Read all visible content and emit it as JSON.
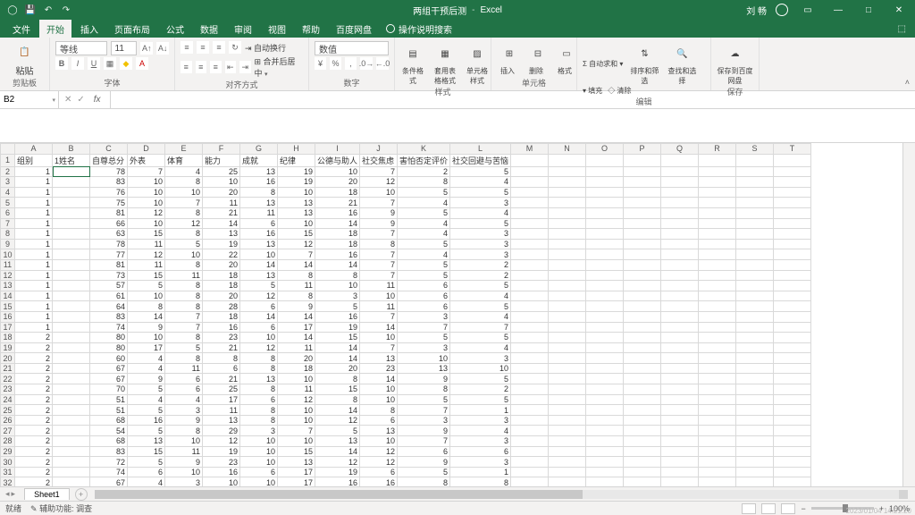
{
  "titlebar": {
    "doc_title": "两组干预后测",
    "app_name": "Excel",
    "user_name": "刘 畅"
  },
  "tabs": {
    "file": "文件",
    "home": "开始",
    "insert": "插入",
    "layout": "页面布局",
    "formulas": "公式",
    "data": "数据",
    "review": "审阅",
    "view": "视图",
    "help": "帮助",
    "baidu": "百度网盘",
    "tell": "操作说明搜索"
  },
  "ribbon": {
    "paste": "粘贴",
    "clipboard": "剪贴板",
    "font_name": "等线",
    "font_size": "11",
    "font_group": "字体",
    "wrap": "自动换行",
    "merge": "合并后居中",
    "align_group": "对齐方式",
    "number_fmt": "数值",
    "number_group": "数字",
    "cond_fmt": "条件格式",
    "tbl_fmt": "套用表格格式",
    "cell_style": "单元格样式",
    "styles_group": "样式",
    "insert_c": "插入",
    "delete_c": "删除",
    "format_c": "格式",
    "cells_group": "单元格",
    "autosum": "自动求和",
    "fill": "填充",
    "clear": "清除",
    "sort": "排序和筛选",
    "find": "查找和选择",
    "editing_group": "编辑",
    "save_cloud": "保存到百度网盘",
    "save_group": "保存"
  },
  "formula": {
    "cell_ref": "B2",
    "fx": "fx"
  },
  "columns": [
    "A",
    "B",
    "C",
    "D",
    "E",
    "F",
    "G",
    "H",
    "I",
    "J",
    "K",
    "L",
    "M",
    "N",
    "O",
    "P",
    "Q",
    "R",
    "S",
    "T"
  ],
  "headers": [
    "组别",
    "1姓名",
    "自尊总分",
    "外表",
    "体育",
    "能力",
    "成就",
    "纪律",
    "公德与助人",
    "社交焦虑",
    "害怕否定评价",
    "社交回避与苦恼"
  ],
  "rows": [
    [
      1,
      "",
      78,
      7,
      4,
      25,
      13,
      19,
      10,
      7,
      2,
      5
    ],
    [
      1,
      "",
      83,
      10,
      8,
      10,
      16,
      19,
      20,
      12,
      8,
      4
    ],
    [
      1,
      "",
      76,
      10,
      10,
      20,
      8,
      10,
      18,
      10,
      5,
      5
    ],
    [
      1,
      "",
      75,
      10,
      7,
      11,
      13,
      13,
      21,
      7,
      4,
      3
    ],
    [
      1,
      "",
      81,
      12,
      8,
      21,
      11,
      13,
      16,
      9,
      5,
      4
    ],
    [
      1,
      "",
      66,
      10,
      12,
      14,
      6,
      10,
      14,
      9,
      4,
      5
    ],
    [
      1,
      "",
      63,
      15,
      8,
      13,
      16,
      15,
      18,
      7,
      4,
      3
    ],
    [
      1,
      "",
      78,
      11,
      5,
      19,
      13,
      12,
      18,
      8,
      5,
      3
    ],
    [
      1,
      "",
      77,
      12,
      10,
      22,
      10,
      7,
      16,
      7,
      4,
      3
    ],
    [
      1,
      "",
      81,
      11,
      8,
      20,
      14,
      14,
      14,
      7,
      5,
      2
    ],
    [
      1,
      "",
      73,
      15,
      11,
      18,
      13,
      8,
      8,
      7,
      5,
      2
    ],
    [
      1,
      "",
      57,
      5,
      8,
      18,
      5,
      11,
      10,
      11,
      6,
      5
    ],
    [
      1,
      "",
      61,
      10,
      8,
      20,
      12,
      8,
      3,
      10,
      6,
      4
    ],
    [
      1,
      "",
      64,
      8,
      8,
      28,
      6,
      9,
      5,
      11,
      6,
      5
    ],
    [
      1,
      "",
      83,
      14,
      7,
      18,
      14,
      14,
      16,
      7,
      3,
      4
    ],
    [
      1,
      "",
      74,
      9,
      7,
      16,
      6,
      17,
      19,
      14,
      7,
      7
    ],
    [
      2,
      "",
      80,
      10,
      8,
      23,
      10,
      14,
      15,
      10,
      5,
      5
    ],
    [
      2,
      "",
      80,
      17,
      5,
      21,
      12,
      11,
      14,
      7,
      3,
      4
    ],
    [
      2,
      "",
      60,
      4,
      8,
      8,
      8,
      20,
      14,
      13,
      10,
      3
    ],
    [
      2,
      "",
      67,
      4,
      11,
      6,
      8,
      18,
      20,
      23,
      13,
      10
    ],
    [
      2,
      "",
      67,
      9,
      6,
      21,
      13,
      10,
      8,
      14,
      9,
      5
    ],
    [
      2,
      "",
      70,
      5,
      6,
      25,
      8,
      11,
      15,
      10,
      8,
      2
    ],
    [
      2,
      "",
      51,
      4,
      4,
      17,
      6,
      12,
      8,
      10,
      5,
      5
    ],
    [
      2,
      "",
      51,
      5,
      3,
      11,
      8,
      10,
      14,
      8,
      7,
      1
    ],
    [
      2,
      "",
      68,
      16,
      9,
      13,
      8,
      10,
      12,
      6,
      3,
      3
    ],
    [
      2,
      "",
      54,
      5,
      8,
      29,
      3,
      7,
      5,
      13,
      9,
      4
    ],
    [
      2,
      "",
      68,
      13,
      10,
      12,
      10,
      10,
      13,
      10,
      7,
      3
    ],
    [
      2,
      "",
      83,
      15,
      11,
      19,
      10,
      15,
      14,
      12,
      6,
      6
    ],
    [
      2,
      "",
      72,
      5,
      9,
      23,
      10,
      13,
      12,
      12,
      9,
      3
    ],
    [
      2,
      "",
      74,
      6,
      10,
      16,
      6,
      17,
      19,
      6,
      5,
      1
    ],
    [
      2,
      "",
      67,
      4,
      3,
      10,
      10,
      17,
      16,
      16,
      8,
      8
    ]
  ],
  "sheet": {
    "name": "Sheet1"
  },
  "status": {
    "ready": "就绪",
    "acc": "辅助功能: 调查",
    "zoom": "100%",
    "timestamp": "2023/01/04 14:21:20"
  }
}
